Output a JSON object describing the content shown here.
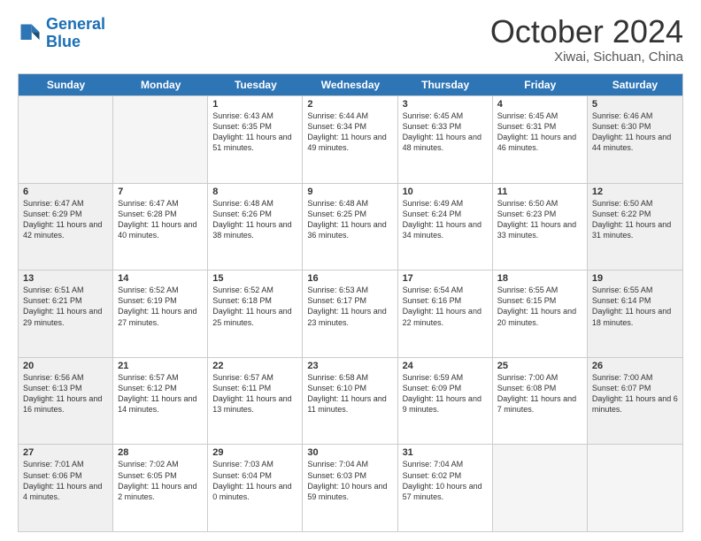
{
  "header": {
    "logo_line1": "General",
    "logo_line2": "Blue",
    "month": "October 2024",
    "location": "Xiwai, Sichuan, China"
  },
  "weekdays": [
    "Sunday",
    "Monday",
    "Tuesday",
    "Wednesday",
    "Thursday",
    "Friday",
    "Saturday"
  ],
  "rows": [
    [
      {
        "day": "",
        "info": "",
        "empty": true
      },
      {
        "day": "",
        "info": "",
        "empty": true
      },
      {
        "day": "1",
        "info": "Sunrise: 6:43 AM\nSunset: 6:35 PM\nDaylight: 11 hours and 51 minutes.",
        "empty": false
      },
      {
        "day": "2",
        "info": "Sunrise: 6:44 AM\nSunset: 6:34 PM\nDaylight: 11 hours and 49 minutes.",
        "empty": false
      },
      {
        "day": "3",
        "info": "Sunrise: 6:45 AM\nSunset: 6:33 PM\nDaylight: 11 hours and 48 minutes.",
        "empty": false
      },
      {
        "day": "4",
        "info": "Sunrise: 6:45 AM\nSunset: 6:31 PM\nDaylight: 11 hours and 46 minutes.",
        "empty": false
      },
      {
        "day": "5",
        "info": "Sunrise: 6:46 AM\nSunset: 6:30 PM\nDaylight: 11 hours and 44 minutes.",
        "empty": false,
        "shaded": true
      }
    ],
    [
      {
        "day": "6",
        "info": "Sunrise: 6:47 AM\nSunset: 6:29 PM\nDaylight: 11 hours and 42 minutes.",
        "empty": false,
        "shaded": true
      },
      {
        "day": "7",
        "info": "Sunrise: 6:47 AM\nSunset: 6:28 PM\nDaylight: 11 hours and 40 minutes.",
        "empty": false
      },
      {
        "day": "8",
        "info": "Sunrise: 6:48 AM\nSunset: 6:26 PM\nDaylight: 11 hours and 38 minutes.",
        "empty": false
      },
      {
        "day": "9",
        "info": "Sunrise: 6:48 AM\nSunset: 6:25 PM\nDaylight: 11 hours and 36 minutes.",
        "empty": false
      },
      {
        "day": "10",
        "info": "Sunrise: 6:49 AM\nSunset: 6:24 PM\nDaylight: 11 hours and 34 minutes.",
        "empty": false
      },
      {
        "day": "11",
        "info": "Sunrise: 6:50 AM\nSunset: 6:23 PM\nDaylight: 11 hours and 33 minutes.",
        "empty": false
      },
      {
        "day": "12",
        "info": "Sunrise: 6:50 AM\nSunset: 6:22 PM\nDaylight: 11 hours and 31 minutes.",
        "empty": false,
        "shaded": true
      }
    ],
    [
      {
        "day": "13",
        "info": "Sunrise: 6:51 AM\nSunset: 6:21 PM\nDaylight: 11 hours and 29 minutes.",
        "empty": false,
        "shaded": true
      },
      {
        "day": "14",
        "info": "Sunrise: 6:52 AM\nSunset: 6:19 PM\nDaylight: 11 hours and 27 minutes.",
        "empty": false
      },
      {
        "day": "15",
        "info": "Sunrise: 6:52 AM\nSunset: 6:18 PM\nDaylight: 11 hours and 25 minutes.",
        "empty": false
      },
      {
        "day": "16",
        "info": "Sunrise: 6:53 AM\nSunset: 6:17 PM\nDaylight: 11 hours and 23 minutes.",
        "empty": false
      },
      {
        "day": "17",
        "info": "Sunrise: 6:54 AM\nSunset: 6:16 PM\nDaylight: 11 hours and 22 minutes.",
        "empty": false
      },
      {
        "day": "18",
        "info": "Sunrise: 6:55 AM\nSunset: 6:15 PM\nDaylight: 11 hours and 20 minutes.",
        "empty": false
      },
      {
        "day": "19",
        "info": "Sunrise: 6:55 AM\nSunset: 6:14 PM\nDaylight: 11 hours and 18 minutes.",
        "empty": false,
        "shaded": true
      }
    ],
    [
      {
        "day": "20",
        "info": "Sunrise: 6:56 AM\nSunset: 6:13 PM\nDaylight: 11 hours and 16 minutes.",
        "empty": false,
        "shaded": true
      },
      {
        "day": "21",
        "info": "Sunrise: 6:57 AM\nSunset: 6:12 PM\nDaylight: 11 hours and 14 minutes.",
        "empty": false
      },
      {
        "day": "22",
        "info": "Sunrise: 6:57 AM\nSunset: 6:11 PM\nDaylight: 11 hours and 13 minutes.",
        "empty": false
      },
      {
        "day": "23",
        "info": "Sunrise: 6:58 AM\nSunset: 6:10 PM\nDaylight: 11 hours and 11 minutes.",
        "empty": false
      },
      {
        "day": "24",
        "info": "Sunrise: 6:59 AM\nSunset: 6:09 PM\nDaylight: 11 hours and 9 minutes.",
        "empty": false
      },
      {
        "day": "25",
        "info": "Sunrise: 7:00 AM\nSunset: 6:08 PM\nDaylight: 11 hours and 7 minutes.",
        "empty": false
      },
      {
        "day": "26",
        "info": "Sunrise: 7:00 AM\nSunset: 6:07 PM\nDaylight: 11 hours and 6 minutes.",
        "empty": false,
        "shaded": true
      }
    ],
    [
      {
        "day": "27",
        "info": "Sunrise: 7:01 AM\nSunset: 6:06 PM\nDaylight: 11 hours and 4 minutes.",
        "empty": false,
        "shaded": true
      },
      {
        "day": "28",
        "info": "Sunrise: 7:02 AM\nSunset: 6:05 PM\nDaylight: 11 hours and 2 minutes.",
        "empty": false
      },
      {
        "day": "29",
        "info": "Sunrise: 7:03 AM\nSunset: 6:04 PM\nDaylight: 11 hours and 0 minutes.",
        "empty": false
      },
      {
        "day": "30",
        "info": "Sunrise: 7:04 AM\nSunset: 6:03 PM\nDaylight: 10 hours and 59 minutes.",
        "empty": false
      },
      {
        "day": "31",
        "info": "Sunrise: 7:04 AM\nSunset: 6:02 PM\nDaylight: 10 hours and 57 minutes.",
        "empty": false
      },
      {
        "day": "",
        "info": "",
        "empty": true
      },
      {
        "day": "",
        "info": "",
        "empty": true
      }
    ]
  ]
}
